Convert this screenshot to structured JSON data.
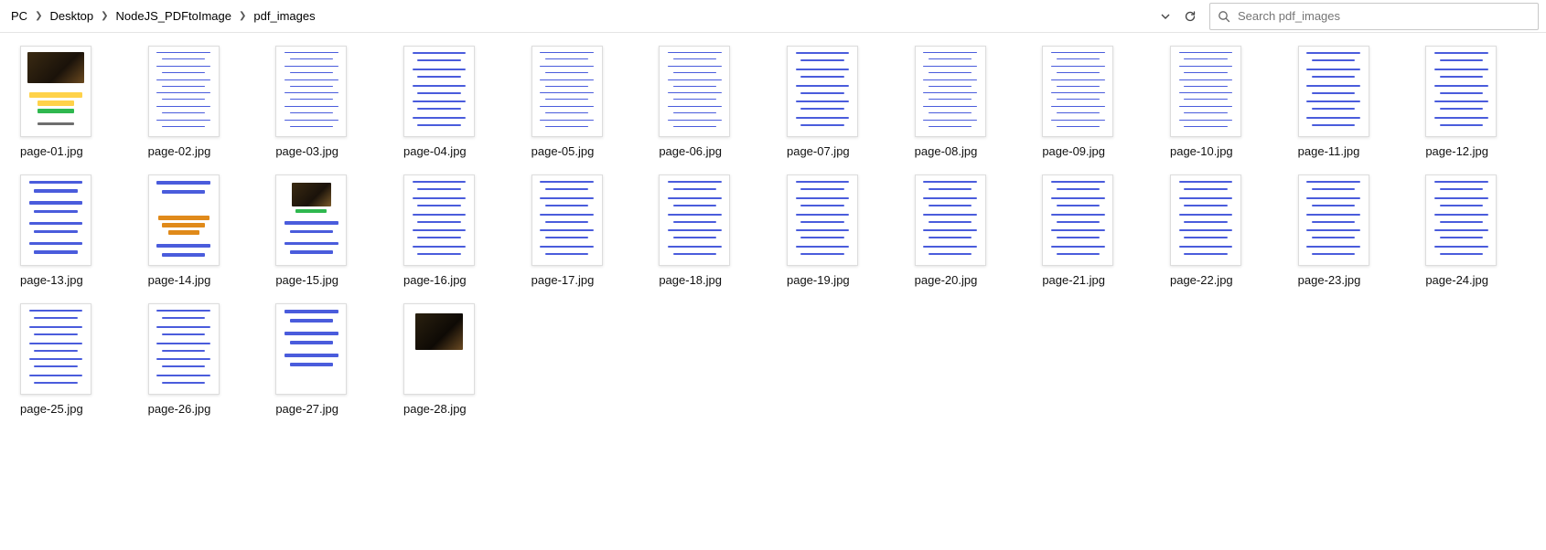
{
  "breadcrumbs": [
    "PC",
    "Desktop",
    "NodeJS_PDFtoImage",
    "pdf_images"
  ],
  "search": {
    "placeholder": "Search pdf_images"
  },
  "files": [
    {
      "name": "page-01.jpg",
      "kind": "cover1"
    },
    {
      "name": "page-02.jpg",
      "kind": "text6"
    },
    {
      "name": "page-03.jpg",
      "kind": "text6"
    },
    {
      "name": "page-04.jpg",
      "kind": "text5"
    },
    {
      "name": "page-05.jpg",
      "kind": "text6"
    },
    {
      "name": "page-06.jpg",
      "kind": "text6"
    },
    {
      "name": "page-07.jpg",
      "kind": "text5"
    },
    {
      "name": "page-08.jpg",
      "kind": "text6"
    },
    {
      "name": "page-09.jpg",
      "kind": "text6"
    },
    {
      "name": "page-10.jpg",
      "kind": "text6"
    },
    {
      "name": "page-11.jpg",
      "kind": "text5"
    },
    {
      "name": "page-12.jpg",
      "kind": "text5"
    },
    {
      "name": "page-13.jpg",
      "kind": "text4"
    },
    {
      "name": "page-14.jpg",
      "kind": "orange"
    },
    {
      "name": "page-15.jpg",
      "kind": "cover15"
    },
    {
      "name": "page-16.jpg",
      "kind": "text5"
    },
    {
      "name": "page-17.jpg",
      "kind": "text5"
    },
    {
      "name": "page-18.jpg",
      "kind": "text5"
    },
    {
      "name": "page-19.jpg",
      "kind": "text5"
    },
    {
      "name": "page-20.jpg",
      "kind": "text5"
    },
    {
      "name": "page-21.jpg",
      "kind": "text5"
    },
    {
      "name": "page-22.jpg",
      "kind": "text5"
    },
    {
      "name": "page-23.jpg",
      "kind": "text5"
    },
    {
      "name": "page-24.jpg",
      "kind": "text5"
    },
    {
      "name": "page-25.jpg",
      "kind": "text5"
    },
    {
      "name": "page-26.jpg",
      "kind": "text5"
    },
    {
      "name": "page-27.jpg",
      "kind": "text3"
    },
    {
      "name": "page-28.jpg",
      "kind": "cover28"
    }
  ]
}
